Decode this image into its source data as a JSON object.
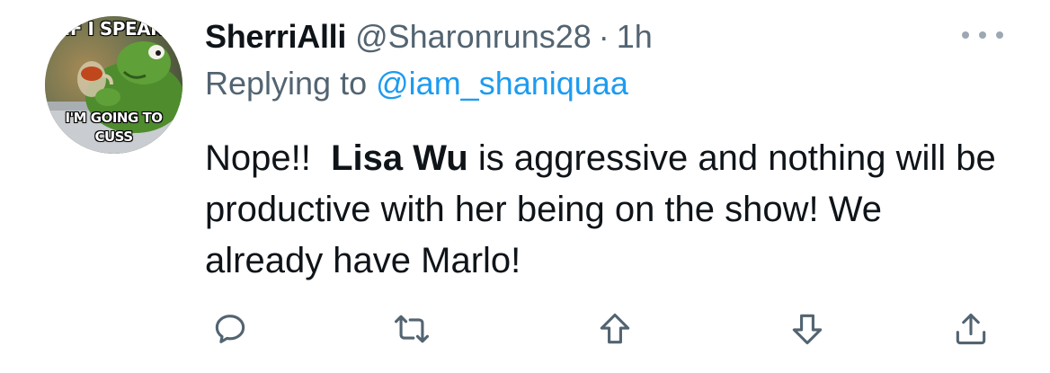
{
  "tweet": {
    "avatar": {
      "caption_top": "IF I SPEAK",
      "caption_bottom_line1": "I'M GOING TO",
      "caption_bottom_line2": "CUSS"
    },
    "display_name": "SherriAlli",
    "handle": "@Sharonruns28",
    "separator": "·",
    "time": "1h",
    "replying_prefix": "Replying to",
    "replying_to": "@iam_shaniquaa",
    "body": {
      "part1": "Nope!!  ",
      "bold_name": "Lisa Wu",
      "part2": " is aggressive and nothing will be productive with her being on the show! We already have Marlo!"
    },
    "actions": {
      "reply_icon": "reply-icon",
      "retweet_icon": "retweet-icon",
      "upvote_icon": "upvote-icon",
      "downvote_icon": "downvote-icon",
      "share_icon": "share-icon"
    },
    "more_icon": "more-icon"
  },
  "colors": {
    "text_primary": "#0f1419",
    "text_secondary": "#536471",
    "link": "#1d9bf0",
    "icon": "#536471"
  }
}
